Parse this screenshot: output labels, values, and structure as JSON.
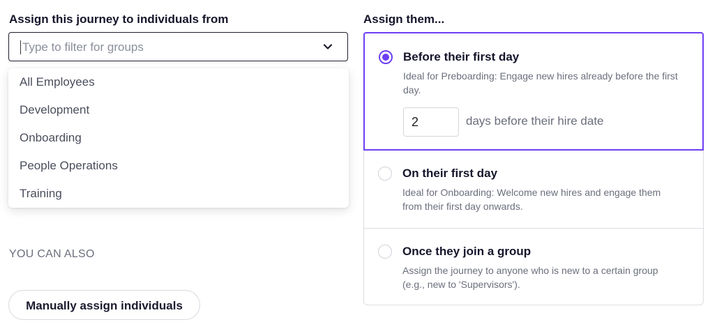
{
  "left": {
    "label": "Assign this journey to individuals from",
    "filter": {
      "placeholder": "Type to filter for groups",
      "value": ""
    },
    "groups": [
      "All Employees",
      "Development",
      "Onboarding",
      "People Operations",
      "Training"
    ],
    "you_can_also": "YOU CAN ALSO",
    "manual_button": "Manually assign individuals"
  },
  "right": {
    "label": "Assign them...",
    "options": [
      {
        "title": "Before their first day",
        "description": "Ideal for Preboarding: Engage new hires already before the first day.",
        "selected": true,
        "days_value": "2",
        "days_suffix": "days before their hire date"
      },
      {
        "title": "On their first day",
        "description": "Ideal for Onboarding: Welcome new hires and engage them from their first day onwards.",
        "selected": false
      },
      {
        "title": "Once they join a group",
        "description": "Assign the journey to anyone who is new to a certain group (e.g., new to 'Supervisors').",
        "selected": false
      }
    ]
  },
  "icons": {
    "dropdown": "chevron-down-icon"
  },
  "colors": {
    "accent": "#6e3ef5",
    "muted_text": "#6b6f7c",
    "border": "#dcdee3"
  }
}
